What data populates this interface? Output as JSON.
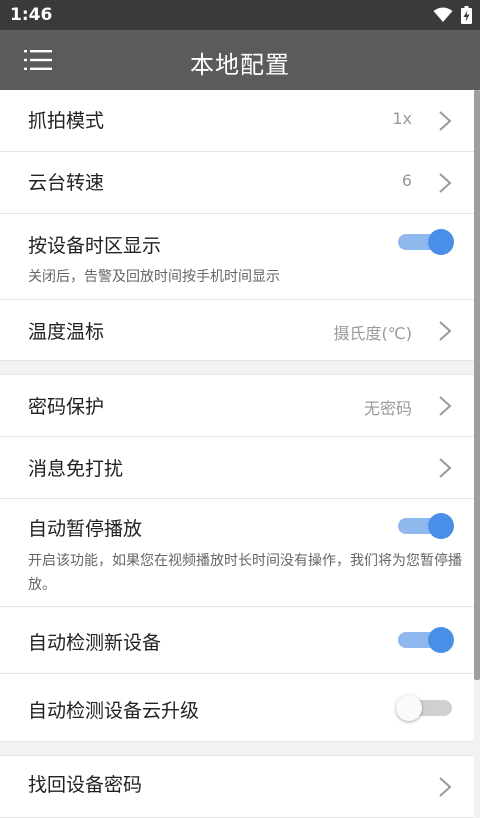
{
  "status_bar": {
    "time": "1:46"
  },
  "app_bar": {
    "title": "本地配置",
    "menu_icon": "menu-icon"
  },
  "colors": {
    "app_bar": "#5b5b5b",
    "status_bar": "#3a3a3a",
    "toggle_on": "#4a8fe7",
    "toggle_on_track": "#8fb8ee",
    "toggle_off_track": "#cfd1cf"
  },
  "settings": {
    "capture_mode": {
      "label": "抓拍模式",
      "value": "1x"
    },
    "ptz_speed": {
      "label": "云台转速",
      "value": "6"
    },
    "device_timezone": {
      "label": "按设备时区显示",
      "enabled": true,
      "description": "关闭后，告警及回放时间按手机时间显示"
    },
    "temperature_unit": {
      "label": "温度温标",
      "value": "摄氏度(℃)"
    },
    "password_protection": {
      "label": "密码保护",
      "value": "无密码"
    },
    "do_not_disturb": {
      "label": "消息免打扰"
    },
    "auto_pause": {
      "label": "自动暂停播放",
      "enabled": true,
      "description": "开启该功能，如果您在视频播放时长时间没有操作，我们将为您暂停播放。"
    },
    "auto_detect_device": {
      "label": "自动检测新设备",
      "enabled": true
    },
    "auto_detect_cloud_upgrade": {
      "label": "自动检测设备云升级",
      "enabled": false
    },
    "recover_password": {
      "label": "找回设备密码"
    }
  }
}
